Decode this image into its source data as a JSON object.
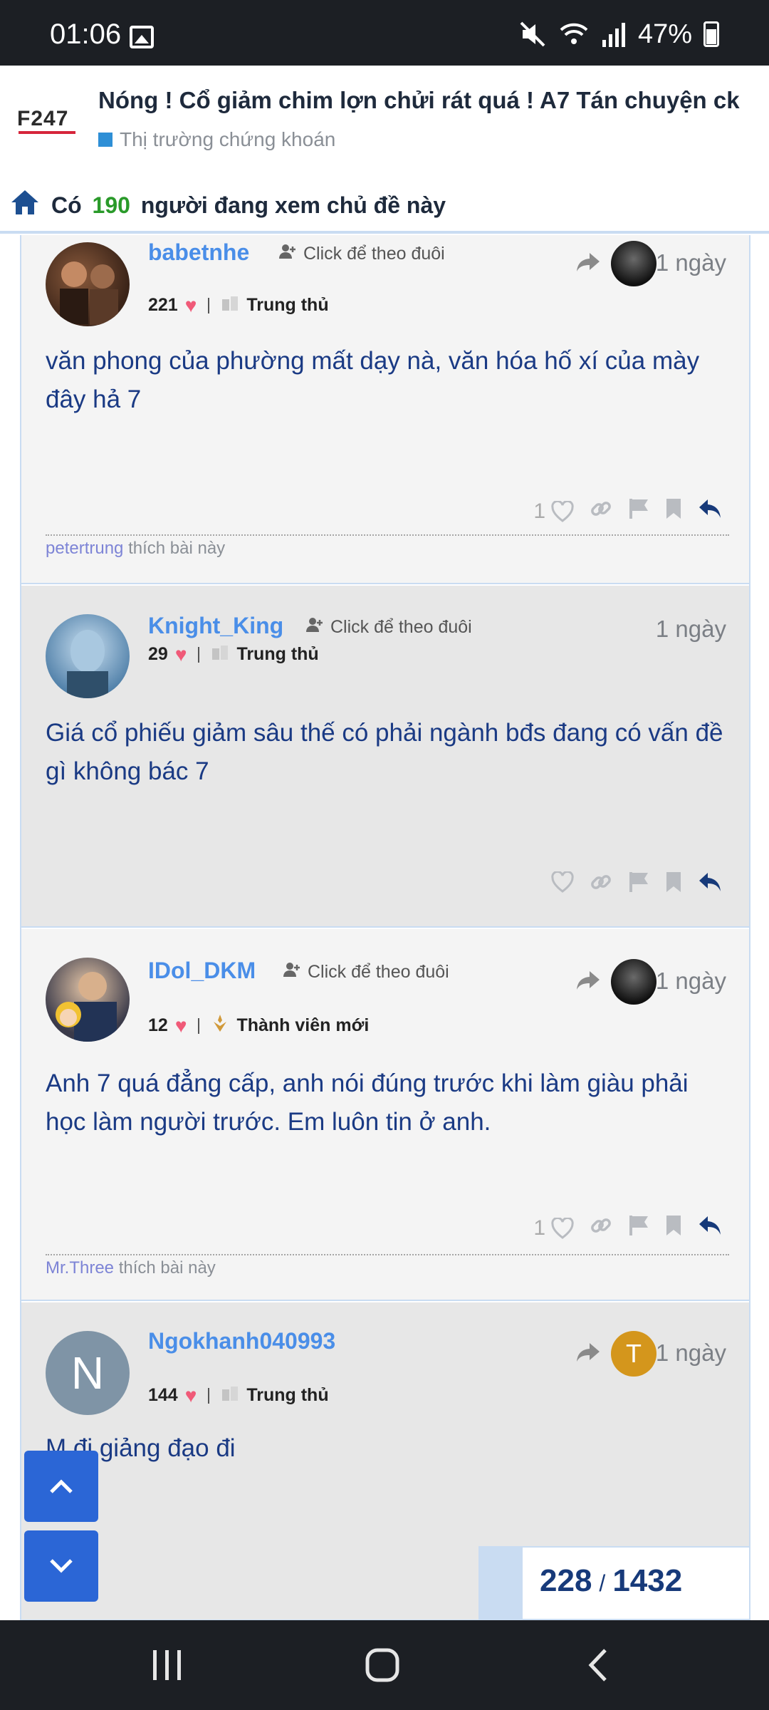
{
  "status_bar": {
    "time": "01:06",
    "battery": "47%"
  },
  "header": {
    "logo": "F247",
    "thread_title": "Nóng ! Cổ giảm chim lợn chửi rát quá ! A7 Tán chuyện ck",
    "forum": "Thị trường chứng khoán"
  },
  "viewers": {
    "prefix": "Có",
    "count": "190",
    "suffix": "người đang xem chủ đề này"
  },
  "follow_label": "Click để theo đuôi",
  "posts": [
    {
      "username": "babetnhe",
      "hearts": "221",
      "rank": "Trung thủ",
      "time": "1 ngày",
      "content": "văn phong của phường mất dạy nà, văn hóa hố xí của mày đây hả 7",
      "like_count": "1",
      "liked_by": "petertrung",
      "liked_suffix": "thích bài này"
    },
    {
      "username": "Knight_King",
      "hearts": "29",
      "rank": "Trung thủ",
      "time": "1 ngày",
      "content": "Giá cổ phiếu giảm sâu thế có phải ngành bđs đang có vấn đề gì không bác 7"
    },
    {
      "username": "IDol_DKM",
      "hearts": "12",
      "rank": "Thành viên mới",
      "time": "1 ngày",
      "content": "Anh 7 quá đẳng cấp, anh nói đúng trước khi làm giàu phải học làm người trước. Em luôn tin ở anh.",
      "like_count": "1",
      "liked_by": "Mr.Three",
      "liked_suffix": "thích bài này"
    },
    {
      "username": "Ngokhanh040993",
      "hearts": "144",
      "rank": "Trung thủ",
      "time": "1 ngày",
      "avatar_letter": "N",
      "reply_avatar_letter": "T",
      "content": "M đi giảng đạo đi"
    }
  ],
  "pager": {
    "current": "228",
    "separator": "/",
    "total": "1432"
  },
  "colors": {
    "accent": "#2b66d6",
    "username": "#4a8ee8",
    "content": "#1a3a84",
    "heart": "#f05a78",
    "viewer_count": "#2a9a2a"
  },
  "icons": [
    "home-icon",
    "follow-icon",
    "heart-icon",
    "share-icon",
    "link-icon",
    "flag-icon",
    "bookmark-icon",
    "reply-icon",
    "chevron-up-icon",
    "chevron-down-icon"
  ]
}
